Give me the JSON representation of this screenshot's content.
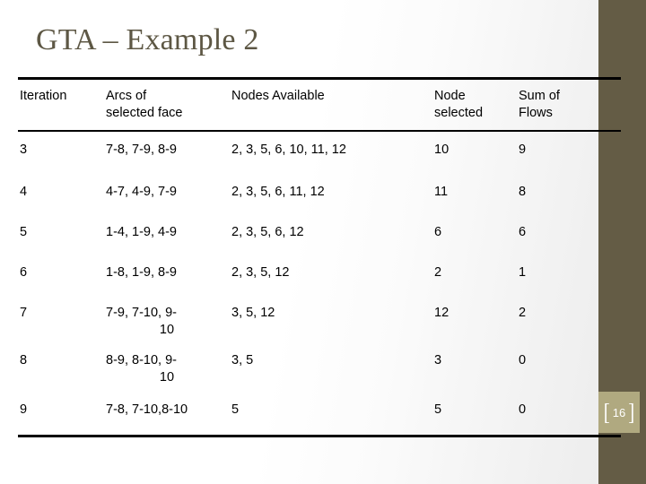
{
  "slide": {
    "title": "GTA – Example 2",
    "page_number": "16",
    "badge_left_bracket": "[",
    "badge_right_bracket": "]",
    "accent_color": "#645c45",
    "badge_color": "#b0a980",
    "title_color": "#5d5744"
  },
  "table": {
    "columns": [
      "Iteration",
      "Arcs of\nselected face",
      "Nodes Available",
      "Node\nselected",
      "Sum of\nFlows"
    ],
    "rows": [
      {
        "iteration": "3",
        "arcs": "7-8, 7-9, 8-9",
        "arcs_line2": "",
        "nodes_available": "2, 3, 5, 6, 10, 11, 12",
        "node_selected": "10",
        "sum_of_flows": "9"
      },
      {
        "iteration": "4",
        "arcs": "4-7, 4-9, 7-9",
        "arcs_line2": "",
        "nodes_available": "2, 3, 5, 6, 11, 12",
        "node_selected": "11",
        "sum_of_flows": "8"
      },
      {
        "iteration": "5",
        "arcs": "1-4, 1-9, 4-9",
        "arcs_line2": "",
        "nodes_available": "2, 3, 5, 6, 12",
        "node_selected": "6",
        "sum_of_flows": "6"
      },
      {
        "iteration": "6",
        "arcs": "1-8, 1-9, 8-9",
        "arcs_line2": "",
        "nodes_available": "2, 3, 5, 12",
        "node_selected": "2",
        "sum_of_flows": "1"
      },
      {
        "iteration": "7",
        "arcs": "7-9, 7-10, 9-",
        "arcs_line2": "10",
        "nodes_available": "3, 5, 12",
        "node_selected": "12",
        "sum_of_flows": "2"
      },
      {
        "iteration": "8",
        "arcs": "8-9, 8-10, 9-",
        "arcs_line2": "10",
        "nodes_available": "3, 5",
        "node_selected": "3",
        "sum_of_flows": "0"
      },
      {
        "iteration": "9",
        "arcs": "7-8, 7-10,8-10",
        "arcs_line2": "",
        "nodes_available": "5",
        "node_selected": "5",
        "sum_of_flows": "0"
      }
    ]
  }
}
